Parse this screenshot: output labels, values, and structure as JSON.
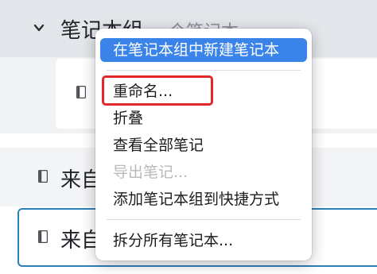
{
  "group": {
    "title": "笔记本组",
    "count_text": "一个笔记本"
  },
  "rows": [
    {
      "label": "来自"
    },
    {
      "label": "来自"
    }
  ],
  "context_menu": {
    "items": [
      {
        "label": "在笔记本组中新建笔记本",
        "state": "highlighted"
      },
      {
        "label": "重命名...",
        "state": "normal"
      },
      {
        "label": "折叠",
        "state": "normal"
      },
      {
        "label": "查看全部笔记",
        "state": "normal"
      },
      {
        "label": "导出笔记...",
        "state": "disabled"
      },
      {
        "label": "添加笔记本组到快捷方式",
        "state": "normal"
      },
      {
        "label": "拆分所有笔记本...",
        "state": "normal"
      }
    ]
  },
  "icons": {
    "chevron": "chevron-down-icon",
    "notebook": "notebook-icon"
  },
  "colors": {
    "menu_highlight": "#3a83e8",
    "annotation": "#e2272b",
    "selected_border": "#2d7fb8"
  }
}
